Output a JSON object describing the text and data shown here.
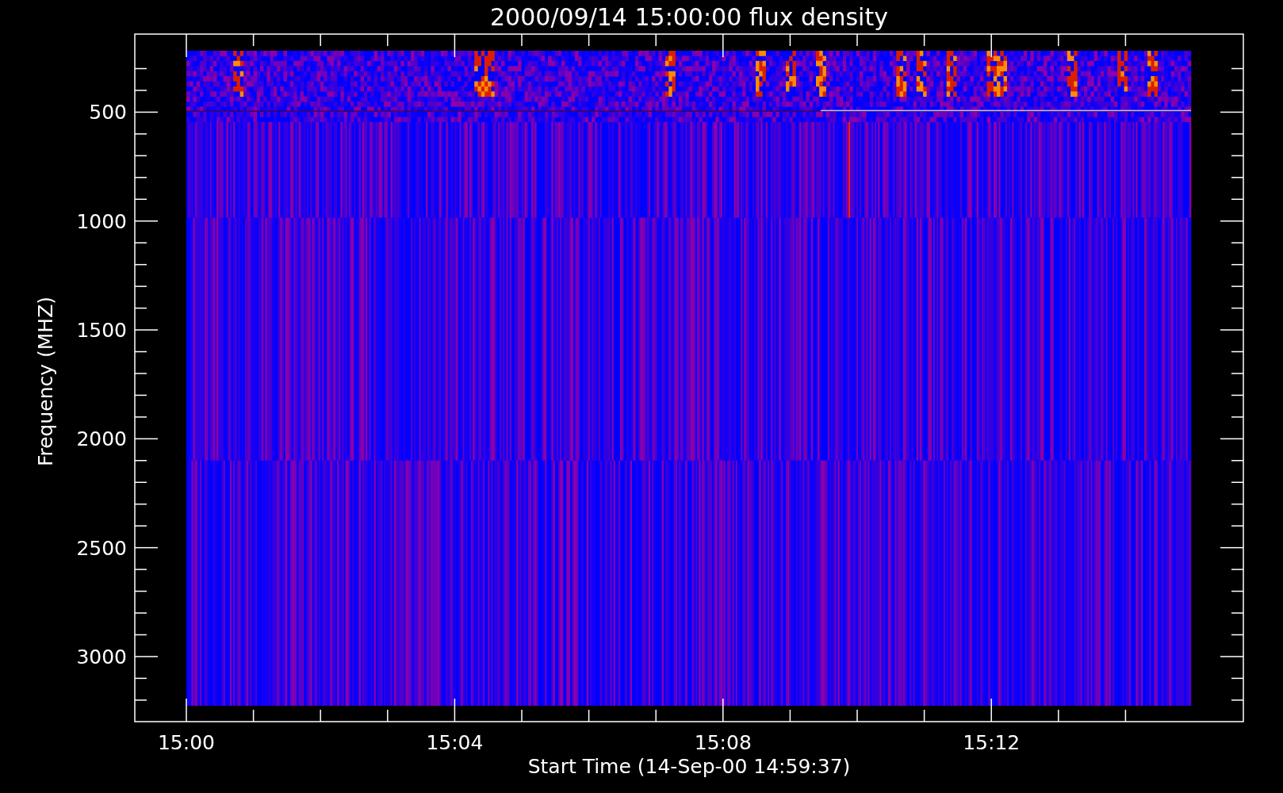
{
  "title": "2000/09/14 15:00:00 flux density",
  "axes": {
    "ylabel": "Frequency (MHZ)",
    "xlabel": "Start Time (14-Sep-00 14:59:37)",
    "yticks": [
      "500",
      "1000",
      "1500",
      "2000",
      "2500",
      "3000"
    ],
    "xticks": [
      "15:00",
      "15:04",
      "15:08",
      "15:12"
    ]
  }
}
